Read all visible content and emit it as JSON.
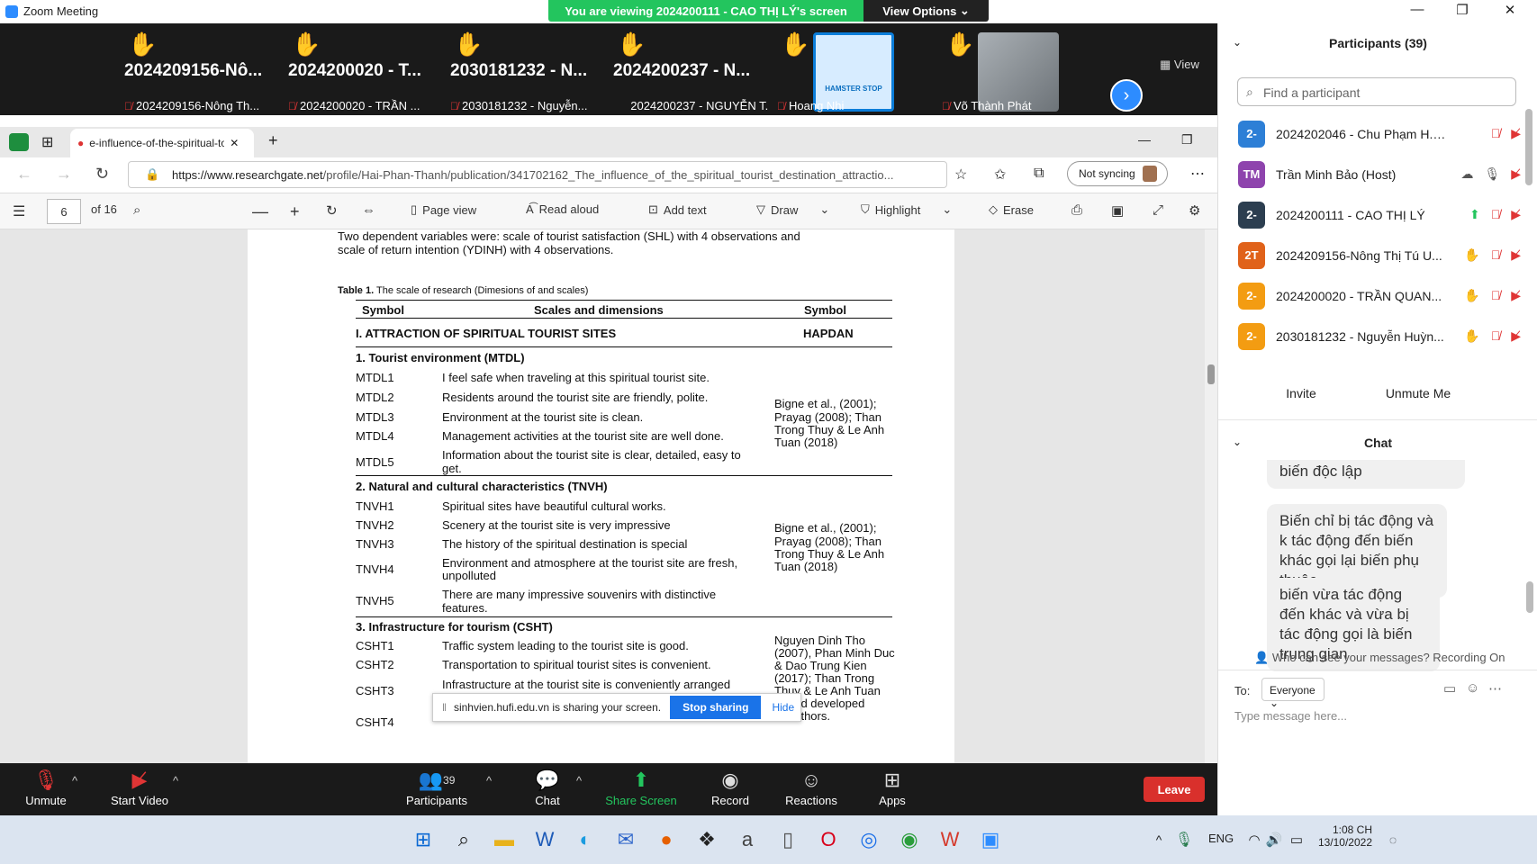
{
  "window": {
    "title": "Zoom Meeting",
    "viewing_banner": "You are viewing 2024200111 - CAO THỊ LÝ's screen",
    "view_options": "View Options"
  },
  "strip": {
    "tiles": [
      {
        "big": "2024209156-Nô...",
        "small": "2024209156-Nông Th..."
      },
      {
        "big": "2024200020 - T...",
        "small": "2024200020 - TRẦN ..."
      },
      {
        "big": "2030181232 - N...",
        "small": "2030181232 - Nguyễn..."
      },
      {
        "big": "2024200237 - N...",
        "small": "2024200237 - NGUYỄN T..."
      },
      {
        "big": "",
        "small": "Hoang Nhi"
      },
      {
        "big": "",
        "small": "Võ Thành Phát"
      }
    ],
    "view_label": "View",
    "hamster_text": "HAMSTER STOP"
  },
  "browser": {
    "tab_title": "e-influence-of-the-spiritual-to",
    "url_host": "https://www.researchgate.net",
    "url_path": "/profile/Hai-Phan-Thanh/publication/341702162_The_influence_of_the_spiritual_tourist_destination_attractio...",
    "sync_label": "Not syncing"
  },
  "pdf_toolbar": {
    "page": "6",
    "of": "of 16",
    "page_view": "Page view",
    "read_aloud": "Read aloud",
    "add_text": "Add text",
    "draw": "Draw",
    "highlight": "Highlight",
    "erase": "Erase"
  },
  "doc": {
    "intro1": "Two dependent variables were: scale of tourist satisfaction (SHL) with 4 observations and",
    "intro2": "scale of return intention (YDINH) with 4 observations.",
    "caption_bold": "Table 1.",
    "caption_rest": " The scale of research (Dimesions  of and scales)",
    "header": {
      "symbol": "Symbol",
      "scales": "Scales and dimensions",
      "symbol2": "Symbol"
    },
    "section_main": "I. ATTRACTION OF SPIRITUAL TOURIST SITES",
    "section_main_code": "HAPDAN",
    "groups": [
      {
        "title": "1. Tourist environment (MTDL)",
        "rows": [
          {
            "code": "MTDL1",
            "text": "I feel safe when traveling at this spiritual tourist site."
          },
          {
            "code": "MTDL2",
            "text": "Residents around the tourist site are friendly, polite."
          },
          {
            "code": "MTDL3",
            "text": "Environment at the tourist site is clean."
          },
          {
            "code": "MTDL4",
            "text": "Management activities at the tourist site are well done."
          },
          {
            "code": "MTDL5",
            "text": "Information about the tourist site is clear, detailed, easy to",
            "text2": "get."
          }
        ],
        "ref": [
          "Bigne et al., (2001);",
          "Prayag (2008); Than",
          "Trong Thuy & Le Anh",
          "Tuan (2018)"
        ]
      },
      {
        "title": "2. Natural and cultural characteristics (TNVH)",
        "rows": [
          {
            "code": "TNVH1",
            "text": "Spiritual sites have beautiful cultural works."
          },
          {
            "code": "TNVH2",
            "text": "Scenery at the tourist site is very impressive"
          },
          {
            "code": "TNVH3",
            "text": "The history of the spiritual destination is special"
          },
          {
            "code": "TNVH4",
            "text": "Environment and atmosphere at the tourist site are fresh,",
            "text2": "unpolluted"
          },
          {
            "code": "TNVH5",
            "text": "There are many impressive souvenirs with distinctive",
            "text2": "features."
          }
        ],
        "ref": [
          "Bigne et al., (2001);",
          "Prayag (2008); Than",
          "Trong Thuy & Le Anh",
          "Tuan (2018)"
        ]
      },
      {
        "title": "3. Infrastructure for tourism (CSHT)",
        "rows": [
          {
            "code": "CSHT1",
            "text": "Traffic system leading to the tourist site is good."
          },
          {
            "code": "CSHT2",
            "text": "Transportation to spiritual tourist sites is convenient."
          },
          {
            "code": "CSHT3",
            "text": "Infrastructure at the tourist site is conveniently arranged"
          },
          {
            "code": "CSHT4",
            "text": ""
          }
        ],
        "ref": [
          "Nguyen Dinh Tho",
          "(2007), Phan Minh Duc",
          "& Dao Trung Kien",
          "(2017); Than Trong",
          "Thuy & Le Anh Tuan",
          "and developed",
          "authors."
        ]
      }
    ],
    "share_bar": {
      "text": "sinhvien.hufi.edu.vn is sharing your screen.",
      "stop": "Stop sharing",
      "hide": "Hide"
    }
  },
  "toolbar": {
    "unmute": "Unmute",
    "start_video": "Start Video",
    "participants": "Participants",
    "participants_count": "39",
    "chat": "Chat",
    "share_screen": "Share Screen",
    "record": "Record",
    "reactions": "Reactions",
    "apps": "Apps",
    "leave": "Leave"
  },
  "panel": {
    "participants_title": "Participants (39)",
    "find_placeholder": "Find a participant",
    "participants": [
      {
        "initials": "2-",
        "name": "2024202046 - Chu Phạm H... (Me)",
        "color": "#2d7fd6"
      },
      {
        "initials": "TM",
        "name": "Trần Minh Bảo (Host)",
        "color": "#8e44ad"
      },
      {
        "initials": "2-",
        "name": "2024200111 - CAO THỊ LÝ",
        "color": "#2c3e50"
      },
      {
        "initials": "2T",
        "name": "2024209156-Nông Thị Tú U...",
        "color": "#e0621a"
      },
      {
        "initials": "2-",
        "name": "2024200020 - TRẦN QUAN...",
        "color": "#f39c12"
      },
      {
        "initials": "2-",
        "name": "2030181232 - Nguyễn Huỳn...",
        "color": "#f39c12"
      }
    ],
    "invite": "Invite",
    "unmute_me": "Unmute Me",
    "chat_title": "Chat",
    "messages": [
      "biến độc lập",
      "Biến chỉ bị tác động và k tác động đến biến khác gọi lại biến phụ thuộc",
      "biến vừa tác động đến khác và vừa bị tác động gọi là biến trung gian"
    ],
    "who_can_see": "Who can see your messages? Recording On",
    "to_label": "To:",
    "to_value": "Everyone",
    "message_placeholder": "Type message here..."
  },
  "taskbar": {
    "lang": "ENG",
    "time": "1:08 CH",
    "date": "13/10/2022"
  }
}
